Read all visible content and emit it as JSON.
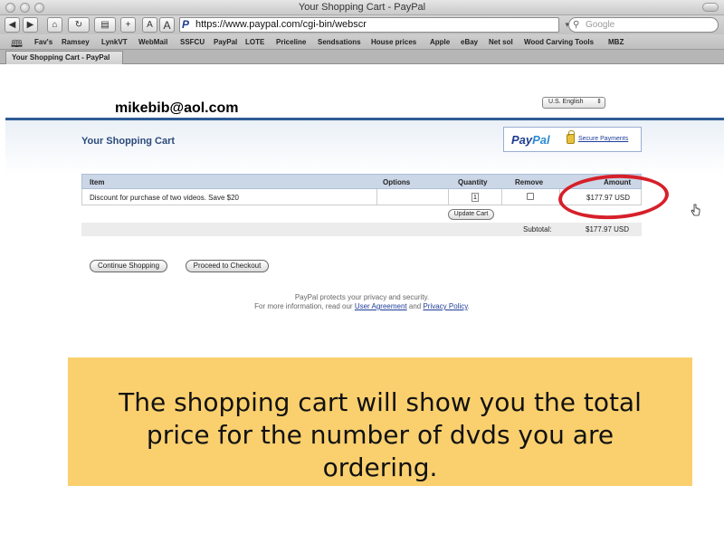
{
  "window": {
    "title": "Your Shopping Cart - PayPal"
  },
  "toolbar": {
    "text_smaller": "A",
    "text_larger": "A",
    "url": "https://www.paypal.com/cgi-bin/webscr",
    "search_placeholder": "Google"
  },
  "bookmarks": [
    "Fav's",
    "Ramsey",
    "LynkVT",
    "WebMail",
    "SSFCU",
    "PayPal",
    "LOTE",
    "Priceline",
    "Sendsations",
    "House prices",
    "Apple",
    "eBay",
    "Net sol",
    "Wood Carving Tools",
    "MBZ"
  ],
  "tabs": [
    {
      "label": "Your Shopping Cart - PayPal"
    }
  ],
  "page": {
    "email": "mikebib@aol.com",
    "language": "U.S. English",
    "cart_title": "Your Shopping Cart",
    "paypal_logo": {
      "part1": "Pay",
      "part2": "Pal"
    },
    "secure_payments": "Secure Payments",
    "table": {
      "headers": {
        "item": "Item",
        "options": "Options",
        "quantity": "Quantity",
        "remove": "Remove",
        "amount": "Amount"
      },
      "rows": [
        {
          "item": "Discount for purchase of two videos. Save $20",
          "options": "",
          "quantity": "1",
          "amount": "$177.97 USD"
        }
      ],
      "update_cart": "Update Cart",
      "subtotal_label": "Subtotal:",
      "subtotal_value": "$177.97 USD"
    },
    "continue_shopping": "Continue Shopping",
    "proceed_to_checkout": "Proceed to Checkout",
    "privacy": {
      "line1": "PayPal protects your privacy and security.",
      "line2_prefix": "For more information, read our ",
      "user_agreement": "User Agreement",
      "and": " and ",
      "privacy_policy": "Privacy Policy",
      "period": "."
    }
  },
  "caption": {
    "text": "The shopping cart will show you the total price for the number of dvds you are ordering."
  },
  "colors": {
    "highlight_ellipse": "#d6202a",
    "caption_background": "#fad06e",
    "header_accent": "#2e5c94"
  }
}
